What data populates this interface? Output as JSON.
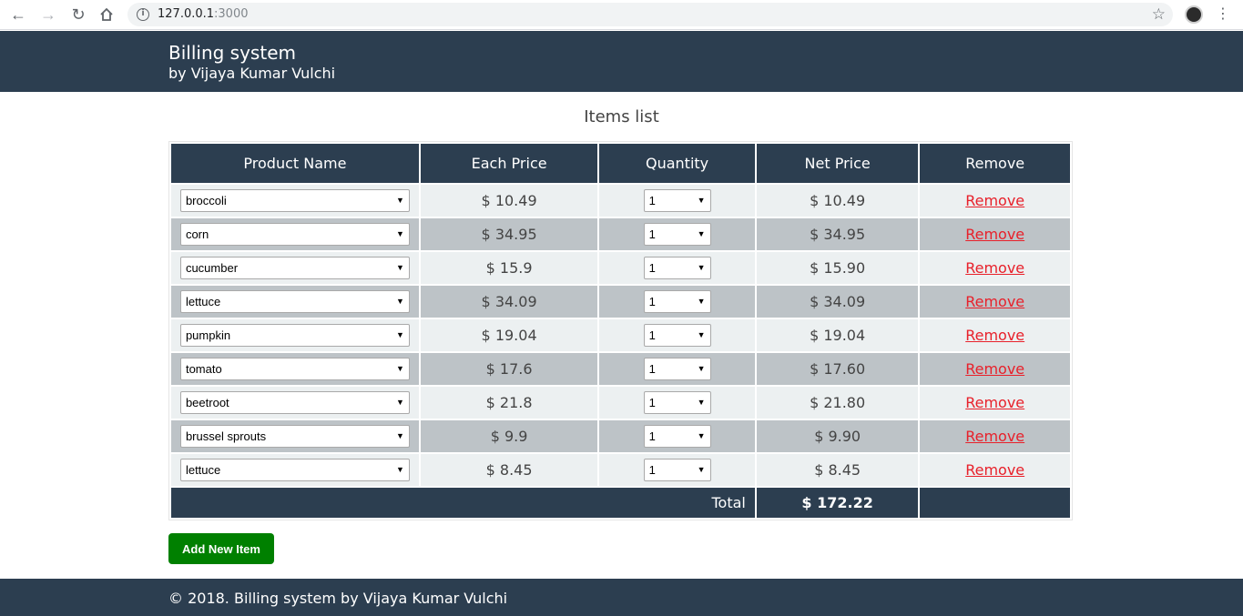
{
  "browser": {
    "url_host": "127.0.0.1",
    "url_port": ":3000",
    "icons": [
      "back-arrow-icon",
      "forward-arrow-icon",
      "reload-icon",
      "home-icon",
      "info-icon",
      "bookmark-star-icon",
      "profile-avatar",
      "kebab-menu-icon"
    ]
  },
  "header": {
    "title": "Billing system",
    "subtitle": "by Vijaya Kumar Vulchi"
  },
  "main": {
    "section_title": "Items list",
    "columns": [
      "Product Name",
      "Each Price",
      "Quantity",
      "Net Price",
      "Remove"
    ],
    "rows": [
      {
        "product": "broccoli",
        "each_price": "$ 10.49",
        "quantity": "1",
        "net_price": "$ 10.49",
        "remove": "Remove"
      },
      {
        "product": "corn",
        "each_price": "$ 34.95",
        "quantity": "1",
        "net_price": "$ 34.95",
        "remove": "Remove"
      },
      {
        "product": "cucumber",
        "each_price": "$ 15.9",
        "quantity": "1",
        "net_price": "$ 15.90",
        "remove": "Remove"
      },
      {
        "product": "lettuce",
        "each_price": "$ 34.09",
        "quantity": "1",
        "net_price": "$ 34.09",
        "remove": "Remove"
      },
      {
        "product": "pumpkin",
        "each_price": "$ 19.04",
        "quantity": "1",
        "net_price": "$ 19.04",
        "remove": "Remove"
      },
      {
        "product": "tomato",
        "each_price": "$ 17.6",
        "quantity": "1",
        "net_price": "$ 17.60",
        "remove": "Remove"
      },
      {
        "product": "beetroot",
        "each_price": "$ 21.8",
        "quantity": "1",
        "net_price": "$ 21.80",
        "remove": "Remove"
      },
      {
        "product": "brussel sprouts",
        "each_price": "$ 9.9",
        "quantity": "1",
        "net_price": "$ 9.90",
        "remove": "Remove"
      },
      {
        "product": "lettuce",
        "each_price": "$ 8.45",
        "quantity": "1",
        "net_price": "$ 8.45",
        "remove": "Remove"
      }
    ],
    "total_label": "Total",
    "total_value": "$ 172.22",
    "add_button_label": "Add New Item"
  },
  "footer": {
    "text": "© 2018. Billing system by Vijaya Kumar Vulchi"
  },
  "colors": {
    "header_bg": "#2c3e50",
    "row_light": "#ecf0f1",
    "row_dark": "#bdc3c7",
    "remove_link": "#e8202a",
    "add_button": "#008000"
  }
}
